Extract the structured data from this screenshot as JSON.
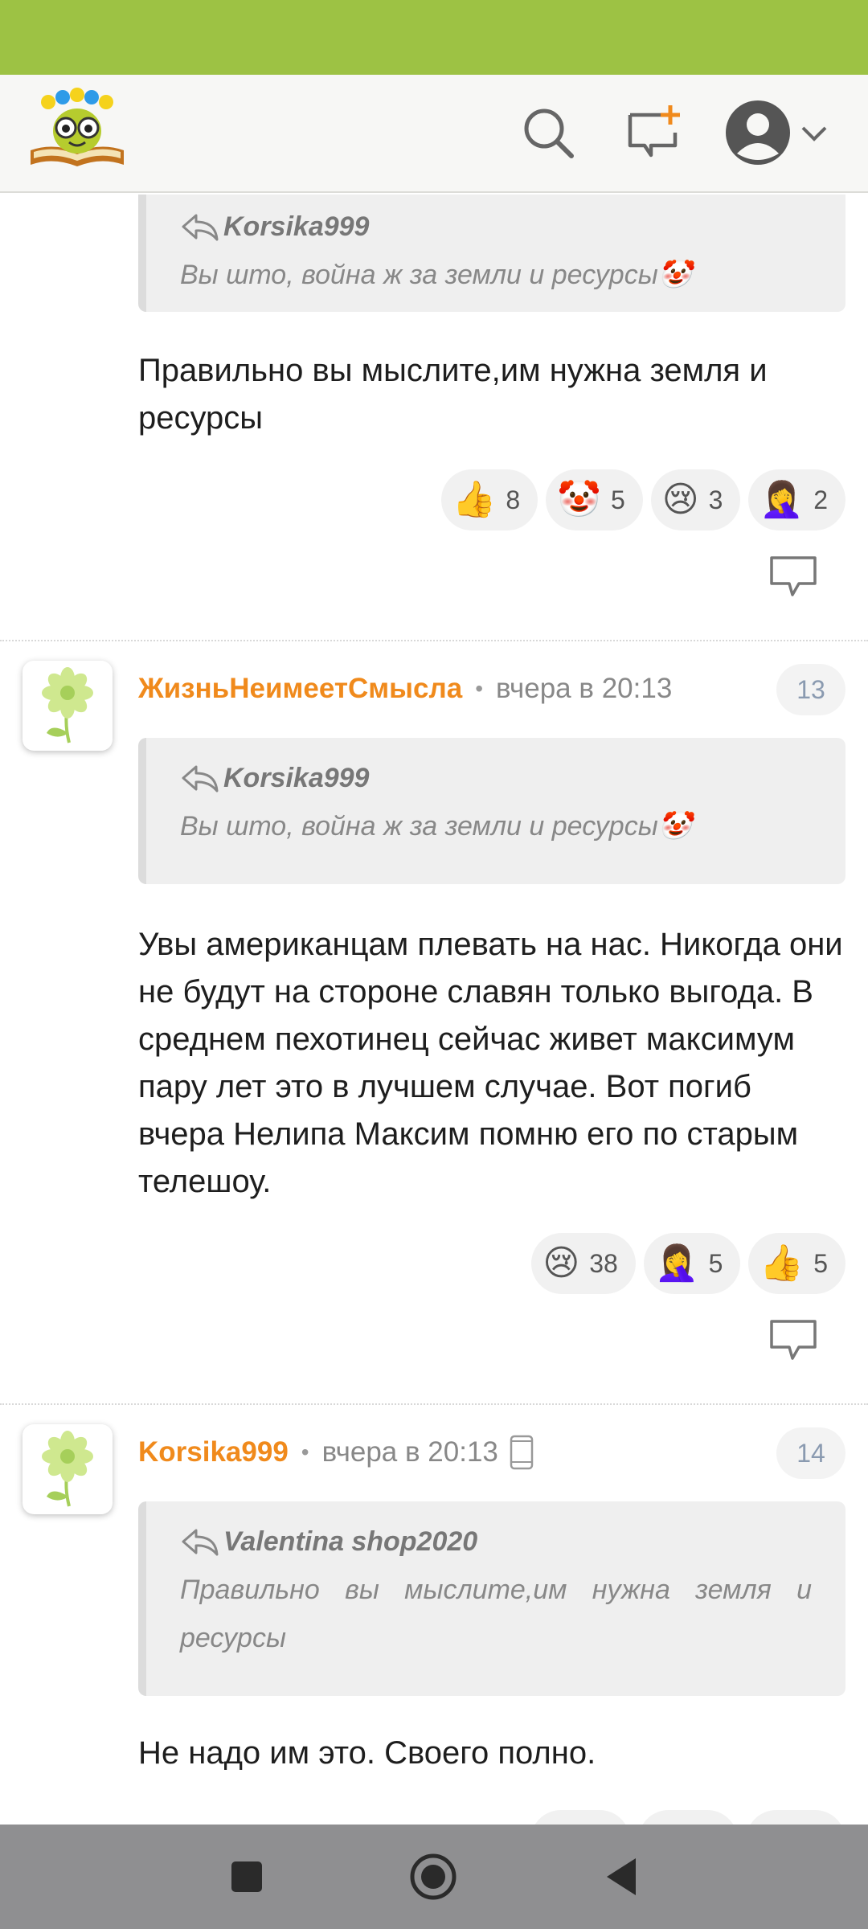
{
  "header": {
    "logo_name": "site-logo",
    "search_icon": "search-icon",
    "new_post_icon": "new-post-icon",
    "profile_icon": "profile-avatar-icon"
  },
  "comments": [
    {
      "quote": {
        "author": "Korsika999",
        "text": "Вы што, война ж за земли и ресурсы🤡"
      },
      "text": "Правильно вы мыслите,им нужна земля и ресурсы",
      "reactions": [
        {
          "emoji": "👍",
          "count": "8"
        },
        {
          "emoji": "🤡",
          "count": "5"
        },
        {
          "emoji": "😢",
          "count": "3"
        },
        {
          "emoji": "🤦‍♀️",
          "count": "2"
        }
      ]
    },
    {
      "author": "ЖизньНеимеетСмысла",
      "time": "вчера в 20:13",
      "number": "13",
      "quote": {
        "author": "Korsika999",
        "text": "Вы што, война ж за земли и ресурсы🤡"
      },
      "text": "Увы американцам плевать на нас. Никогда они не будут на стороне славян только выгода. В среднем пехотинец сейчас живет максимум пару лет это в лучшем случае. Вот погиб вчера Нелипа Максим помню его по старым телешоу.",
      "reactions": [
        {
          "emoji": "😢",
          "count": "38"
        },
        {
          "emoji": "🤦‍♀️",
          "count": "5"
        },
        {
          "emoji": "👍",
          "count": "5"
        }
      ]
    },
    {
      "author": "Korsika999",
      "time": "вчера в 20:13",
      "number": "14",
      "quote": {
        "author": "Valentina shop2020",
        "text": "Правильно вы мыслите,им нужна земля и ресурсы"
      },
      "text": "Не надо им это. Своего полно."
    }
  ],
  "colors": {
    "status_bar": "#9dc244",
    "author": "#f08a1c",
    "nav_bar": "#8f8f91"
  }
}
